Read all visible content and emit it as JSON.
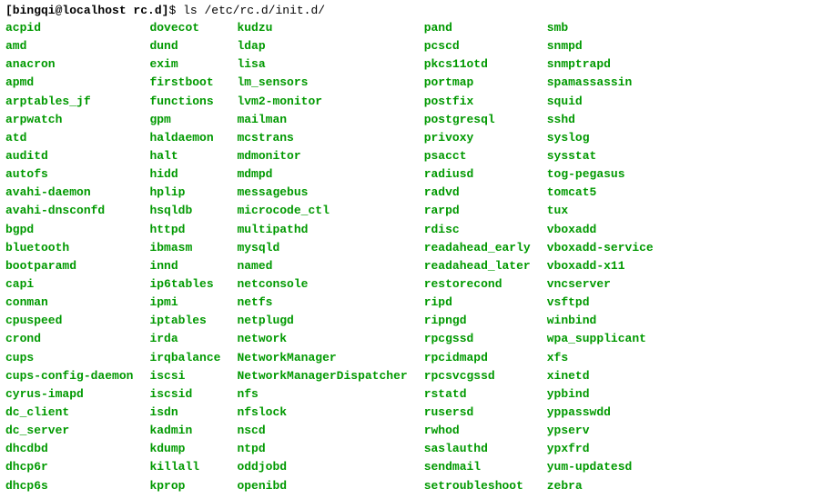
{
  "prompt": {
    "userhost": "[bingqi@localhost rc.d]",
    "symbol": "$",
    "command": "ls /etc/rc.d/init.d/"
  },
  "columns": [
    [
      "acpid",
      "amd",
      "anacron",
      "apmd",
      "arptables_jf",
      "arpwatch",
      "atd",
      "auditd",
      "autofs",
      "avahi-daemon",
      "avahi-dnsconfd",
      "bgpd",
      "bluetooth",
      "bootparamd",
      "capi",
      "conman",
      "cpuspeed",
      "crond",
      "cups",
      "cups-config-daemon",
      "cyrus-imapd",
      "dc_client",
      "dc_server",
      "dhcdbd",
      "dhcp6r",
      "dhcp6s"
    ],
    [
      "dovecot",
      "dund",
      "exim",
      "firstboot",
      "functions",
      "gpm",
      "haldaemon",
      "halt",
      "hidd",
      "hplip",
      "hsqldb",
      "httpd",
      "ibmasm",
      "innd",
      "ip6tables",
      "ipmi",
      "iptables",
      "irda",
      "irqbalance",
      "iscsi",
      "iscsid",
      "isdn",
      "kadmin",
      "kdump",
      "killall",
      "kprop"
    ],
    [
      "kudzu",
      "ldap",
      "lisa",
      "lm_sensors",
      "lvm2-monitor",
      "mailman",
      "mcstrans",
      "mdmonitor",
      "mdmpd",
      "messagebus",
      "microcode_ctl",
      "multipathd",
      "mysqld",
      "named",
      "netconsole",
      "netfs",
      "netplugd",
      "network",
      "NetworkManager",
      "NetworkManagerDispatcher",
      "nfs",
      "nfslock",
      "nscd",
      "ntpd",
      "oddjobd",
      "openibd"
    ],
    [
      "pand",
      "pcscd",
      "pkcs11otd",
      "portmap",
      "postfix",
      "postgresql",
      "privoxy",
      "psacct",
      "radiusd",
      "radvd",
      "rarpd",
      "rdisc",
      "readahead_early",
      "readahead_later",
      "restorecond",
      "ripd",
      "ripngd",
      "rpcgssd",
      "rpcidmapd",
      "rpcsvcgssd",
      "rstatd",
      "rusersd",
      "rwhod",
      "saslauthd",
      "sendmail",
      "setroubleshoot"
    ],
    [
      "smb",
      "snmpd",
      "snmptrapd",
      "spamassassin",
      "squid",
      "sshd",
      "syslog",
      "sysstat",
      "tog-pegasus",
      "tomcat5",
      "tux",
      "vboxadd",
      "vboxadd-service",
      "vboxadd-x11",
      "vncserver",
      "vsftpd",
      "winbind",
      "wpa_supplicant",
      "xfs",
      "xinetd",
      "ypbind",
      "yppasswdd",
      "ypserv",
      "ypxfrd",
      "yum-updatesd",
      "zebra"
    ]
  ]
}
